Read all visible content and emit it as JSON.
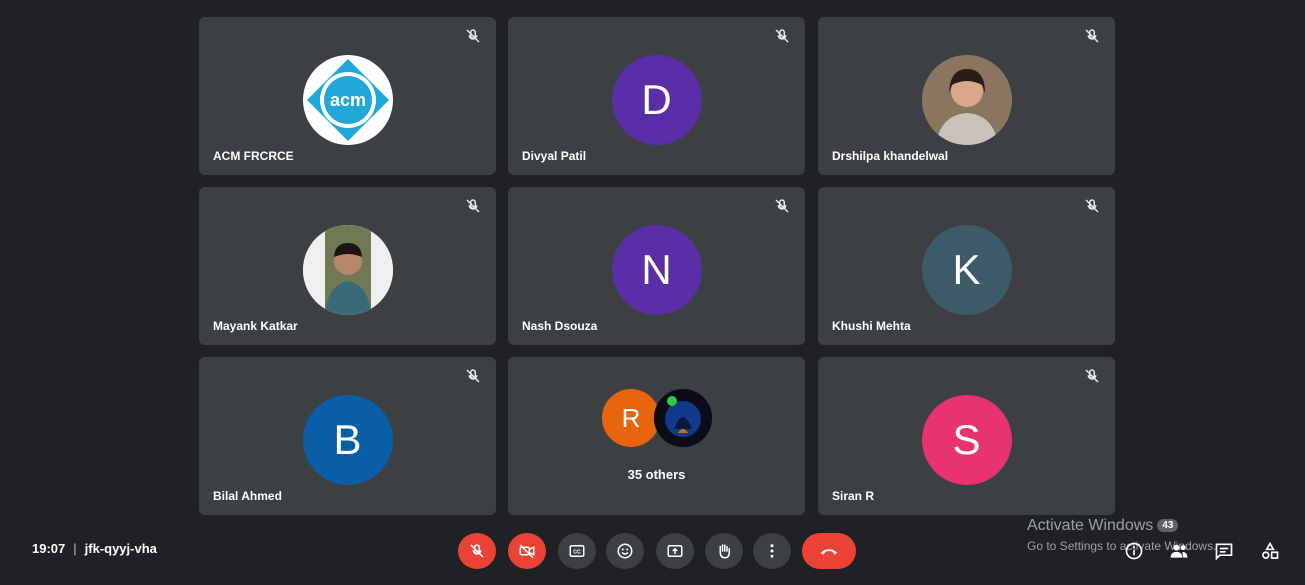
{
  "participants": [
    {
      "name": "ACM FRCRCE",
      "avatar": "acm-logo"
    },
    {
      "name": "Divyal Patil",
      "initial": "D",
      "color": "#5a2ea6"
    },
    {
      "name": "Drshilpa khandelwal",
      "avatar": "photo"
    },
    {
      "name": "Mayank Katkar",
      "avatar": "photo"
    },
    {
      "name": "Nash Dsouza",
      "initial": "N",
      "color": "#5a2ea6"
    },
    {
      "name": "Khushi Mehta",
      "initial": "K",
      "color": "#3d5a68"
    },
    {
      "name": "Bilal Ahmed",
      "initial": "B",
      "color": "#0a5ea8"
    },
    {
      "others_label": "35 others",
      "initial": "R",
      "color": "#e8650f"
    },
    {
      "name": "Siran R",
      "initial": "S",
      "color": "#e8336f"
    }
  ],
  "logo_text": "acm",
  "meeting": {
    "time": "19:07",
    "separator": "|",
    "code": "jfk-qyyj-vha"
  },
  "watermark": {
    "line1": "Activate Windows",
    "line2": "Go to Settings to activate Windows.",
    "badge": "43"
  },
  "colors": {
    "background": "#202124",
    "tile": "#3c4043",
    "danger": "#ea4335"
  },
  "icons": [
    "mic-off-icon",
    "camera-off-icon",
    "captions-icon",
    "emoji-icon",
    "present-icon",
    "raise-hand-icon",
    "more-options-icon",
    "end-call-icon",
    "info-icon",
    "people-icon",
    "chat-icon",
    "activities-icon"
  ]
}
